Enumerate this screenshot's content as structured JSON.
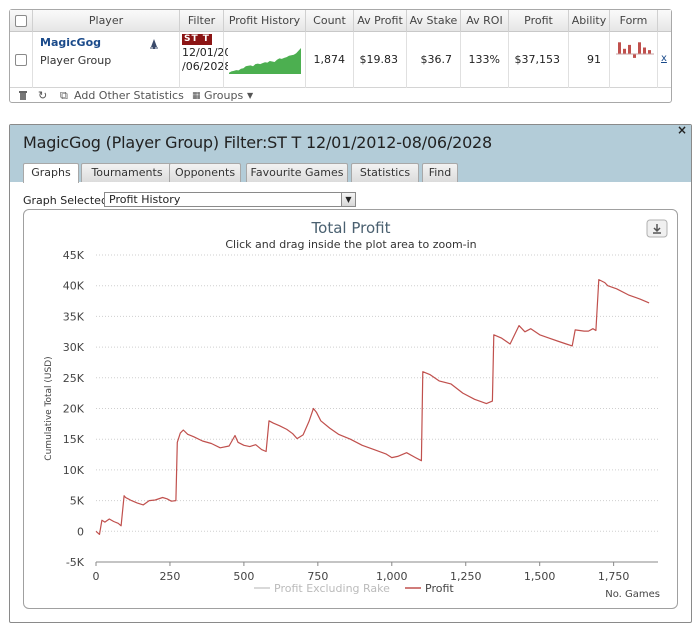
{
  "grid": {
    "columns": [
      "Player",
      "Filter",
      "Profit History",
      "Count",
      "Av Profit",
      "Av Stake",
      "Av ROI",
      "Profit",
      "Ability",
      "Form"
    ],
    "row": {
      "player_name": "MagicGog",
      "player_group": "Player Group",
      "filter_badge": "ST T",
      "filter_line1": "12/01/20",
      "filter_line2": "/06/2028",
      "count": "1,874",
      "av_profit": "$19.83",
      "av_stake": "$36.7",
      "av_roi": "133%",
      "profit": "$37,153",
      "ability": "91",
      "remove": "x"
    }
  },
  "toolbar": {
    "add_stats": "Add Other Statistics",
    "groups": "Groups"
  },
  "window": {
    "title": "MagicGog (Player Group) Filter:ST T 12/01/2012-08/06/2028",
    "close": "×"
  },
  "tabs": [
    "Graphs",
    "Tournaments",
    "Opponents",
    "Favourite Games",
    "Statistics",
    "Find"
  ],
  "graph_selector": {
    "label": "Graph Selected:",
    "value": "Profit History"
  },
  "colors": {
    "profit_line": "#c0504d",
    "mini_chart": "#4caf50",
    "title_bar": "#b3ccd8",
    "form_bar": "#c0504d"
  },
  "chart_data": {
    "type": "line",
    "title": "Total Profit",
    "subtitle": "Click and drag inside the plot area to zoom-in",
    "ylabel": "Cumulative Total (USD)",
    "xlabel": "No. Games",
    "xlim": [
      0,
      1900
    ],
    "ylim": [
      -5000,
      45000
    ],
    "x_ticks": [
      "0",
      "250",
      "500",
      "750",
      "1,000",
      "1,250",
      "1,500",
      "1,750"
    ],
    "y_ticks": [
      "-5K",
      "0",
      "5K",
      "10K",
      "15K",
      "20K",
      "25K",
      "30K",
      "35K",
      "40K",
      "45K"
    ],
    "legend": [
      "Profit Excluding Rake",
      "Profit"
    ],
    "legend_position": "bottom",
    "series": [
      {
        "name": "Profit",
        "x": [
          0,
          12,
          20,
          30,
          45,
          60,
          75,
          85,
          95,
          100,
          120,
          140,
          160,
          180,
          200,
          225,
          240,
          255,
          270,
          275,
          285,
          295,
          310,
          330,
          360,
          390,
          420,
          450,
          470,
          480,
          500,
          520,
          540,
          560,
          575,
          585,
          600,
          620,
          645,
          665,
          680,
          700,
          720,
          735,
          745,
          760,
          790,
          820,
          860,
          900,
          940,
          980,
          1000,
          1020,
          1050,
          1080,
          1100,
          1105,
          1130,
          1160,
          1200,
          1240,
          1280,
          1320,
          1340,
          1345,
          1370,
          1400,
          1430,
          1450,
          1470,
          1500,
          1530,
          1560,
          1590,
          1610,
          1620,
          1650,
          1665,
          1680,
          1690,
          1700,
          1720,
          1730,
          1760,
          1800,
          1840,
          1870
        ],
        "y": [
          0,
          -500,
          1800,
          1500,
          2000,
          1600,
          1300,
          900,
          5800,
          5500,
          5000,
          4600,
          4300,
          5000,
          5100,
          5500,
          5300,
          4900,
          5000,
          14500,
          16000,
          16500,
          15800,
          15400,
          14700,
          14300,
          13600,
          13900,
          15600,
          14500,
          14000,
          13800,
          14100,
          13300,
          13000,
          18000,
          17600,
          17200,
          16600,
          15900,
          15100,
          15700,
          17900,
          20000,
          19400,
          18000,
          16800,
          15800,
          15000,
          14000,
          13300,
          12600,
          12000,
          12200,
          12800,
          12000,
          11500,
          26000,
          25500,
          24500,
          24000,
          22500,
          21500,
          20800,
          21200,
          32000,
          31500,
          30500,
          33500,
          32500,
          33000,
          32000,
          31500,
          31000,
          30500,
          30200,
          32800,
          32600,
          32600,
          33000,
          32700,
          41000,
          40500,
          40000,
          39500,
          38500,
          37800,
          37200
        ]
      },
      {
        "name": "Profit Excluding Rake",
        "x": [],
        "y": []
      }
    ]
  },
  "mini_chart": [
    0.05,
    0.1,
    0.12,
    0.15,
    0.14,
    0.2,
    0.22,
    0.3,
    0.32,
    0.33,
    0.3,
    0.38,
    0.4,
    0.38,
    0.42,
    0.45,
    0.44,
    0.5,
    0.48,
    0.46,
    0.55,
    0.6,
    0.58,
    0.62,
    0.65,
    0.7,
    0.72,
    0.74,
    0.8,
    0.9,
    1.0
  ],
  "form_bars": [
    0.9,
    0.4,
    0.7,
    -0.3,
    0.9,
    0.5,
    0.3
  ]
}
